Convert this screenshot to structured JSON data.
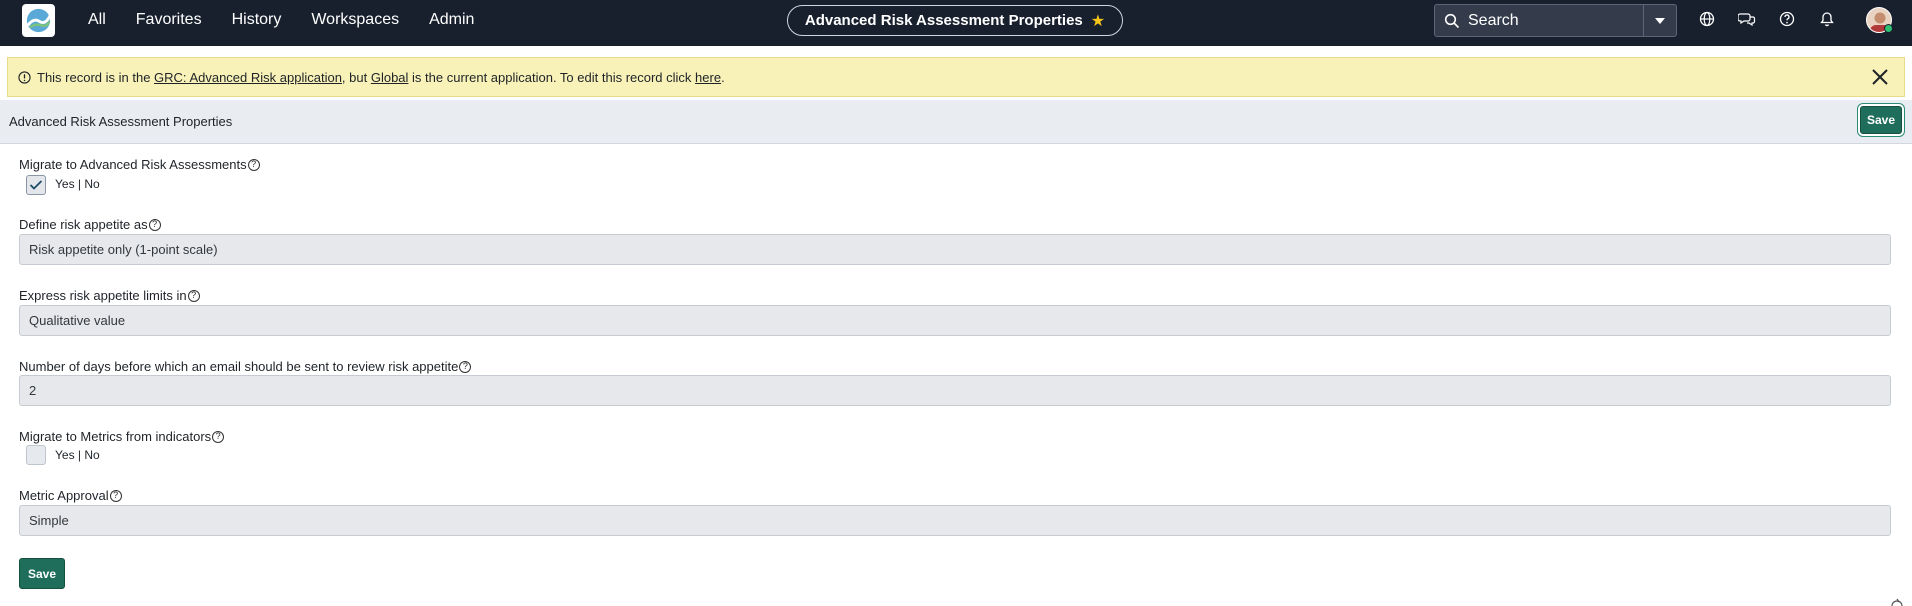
{
  "nav": {
    "menu": [
      "All",
      "Favorites",
      "History",
      "Workspaces",
      "Admin"
    ],
    "title": "Advanced Risk Assessment Properties",
    "search_placeholder": "Search"
  },
  "banner": {
    "text_1": "This record is in the ",
    "link_app": "GRC: Advanced Risk application",
    "text_2": ", but ",
    "link_global": "Global",
    "text_3": " is the current application. To edit this record click ",
    "link_here": "here",
    "text_4": "."
  },
  "form": {
    "title": "Advanced Risk Assessment Properties",
    "save_label": "Save",
    "fields": [
      {
        "label": "Migrate to Advanced Risk Assessments",
        "type": "checkbox",
        "checked": true,
        "option_text": "Yes | No"
      },
      {
        "label": "Define risk appetite as",
        "type": "text",
        "value": "Risk appetite only (1-point scale)"
      },
      {
        "label": "Express risk appetite limits in",
        "type": "text",
        "value": "Qualitative value"
      },
      {
        "label": "Number of days before which an email should be sent to review risk appetite",
        "type": "text",
        "value": "2"
      },
      {
        "label": "Migrate to Metrics from indicators",
        "type": "checkbox",
        "checked": false,
        "option_text": "Yes | No"
      },
      {
        "label": "Metric Approval",
        "type": "text",
        "value": "Simple"
      }
    ]
  },
  "help_glyph": "?",
  "colors": {
    "nav_bg": "#18202e",
    "banner_bg": "#f8f2b8",
    "save_bg": "#1f6e5c"
  }
}
